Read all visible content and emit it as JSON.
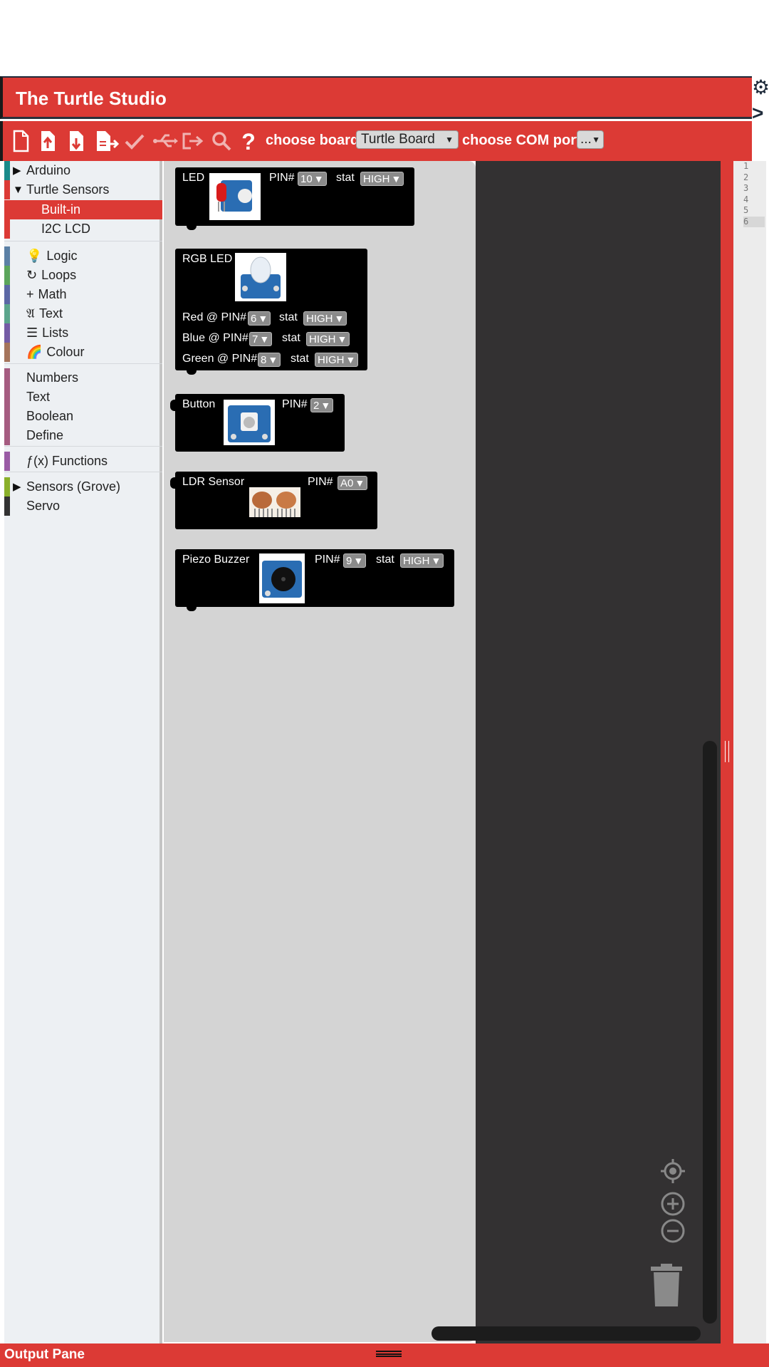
{
  "app": {
    "title": "The Turtle Studio"
  },
  "toolbar": {
    "icons": [
      "new-file-icon",
      "open-file-icon",
      "save-file-icon",
      "save-as-icon",
      "verify-icon",
      "usb-icon",
      "upload-icon",
      "search-icon",
      "help-icon"
    ],
    "board_label": "choose board",
    "board_value": "Turtle Board",
    "com_label": "choose COM port",
    "com_value": "..."
  },
  "toolbox": {
    "items": [
      {
        "label": "Arduino",
        "expander": "▶",
        "color": "#1a8a8a"
      },
      {
        "label": "Turtle Sensors",
        "expander": "▼",
        "color": "#dc3a35"
      },
      {
        "label": "Built-in",
        "color": "#dc3a35",
        "selected": true
      },
      {
        "label": "I2C LCD",
        "color": "#dc3a35"
      },
      {
        "label": "Logic",
        "icon": "💡",
        "color": "#5b80a5"
      },
      {
        "label": "Loops",
        "icon": "↻",
        "color": "#5ba55b"
      },
      {
        "label": "Math",
        "icon": "+",
        "color": "#5b67a5"
      },
      {
        "label": "Text",
        "icon": "𝔄",
        "color": "#5ba58c"
      },
      {
        "label": "Lists",
        "icon": "☰",
        "color": "#745ba5"
      },
      {
        "label": "Colour",
        "icon": "🌈",
        "color": "#a5745b"
      },
      {
        "label": "Numbers",
        "color": "#a55b80"
      },
      {
        "label": "Text",
        "color": "#a55b80"
      },
      {
        "label": "Boolean",
        "color": "#a55b80"
      },
      {
        "label": "Define",
        "color": "#a55b80"
      },
      {
        "label": "ƒ(x) Functions",
        "color": "#9a5ba5"
      },
      {
        "label": "Sensors (Grove)",
        "expander": "▶",
        "color": "#8ab02a"
      },
      {
        "label": "Servo",
        "color": "#333333"
      }
    ]
  },
  "blocks": {
    "led": {
      "title": "LED",
      "pin_label": "PIN#",
      "pin": "10",
      "stat_label": "stat",
      "stat": "HIGH"
    },
    "rgb": {
      "title": "RGB LED",
      "rows": [
        {
          "label": "Red @ PIN#",
          "pin": "6",
          "stat_label": "stat",
          "stat": "HIGH"
        },
        {
          "label": "Blue @ PIN#",
          "pin": "7",
          "stat_label": "stat",
          "stat": "HIGH"
        },
        {
          "label": "Green @ PIN#",
          "pin": "8",
          "stat_label": "stat",
          "stat": "HIGH"
        }
      ]
    },
    "button": {
      "title": "Button",
      "pin_label": "PIN#",
      "pin": "2"
    },
    "ldr": {
      "title": "LDR Sensor",
      "pin_label": "PIN#",
      "pin": "A0"
    },
    "buzzer": {
      "title": "Piezo Buzzer",
      "pin_label": "PIN#",
      "pin": "9",
      "stat_label": "stat",
      "stat": "HIGH"
    }
  },
  "caret": "▼",
  "code": {
    "lines": [
      "1",
      "2",
      "3",
      "4",
      "5",
      "6"
    ],
    "active_line": "6"
  },
  "output": {
    "title": "Output Pane"
  },
  "workspace_controls": [
    "recenter-icon",
    "zoom-in-icon",
    "zoom-out-icon",
    "trash-icon"
  ]
}
